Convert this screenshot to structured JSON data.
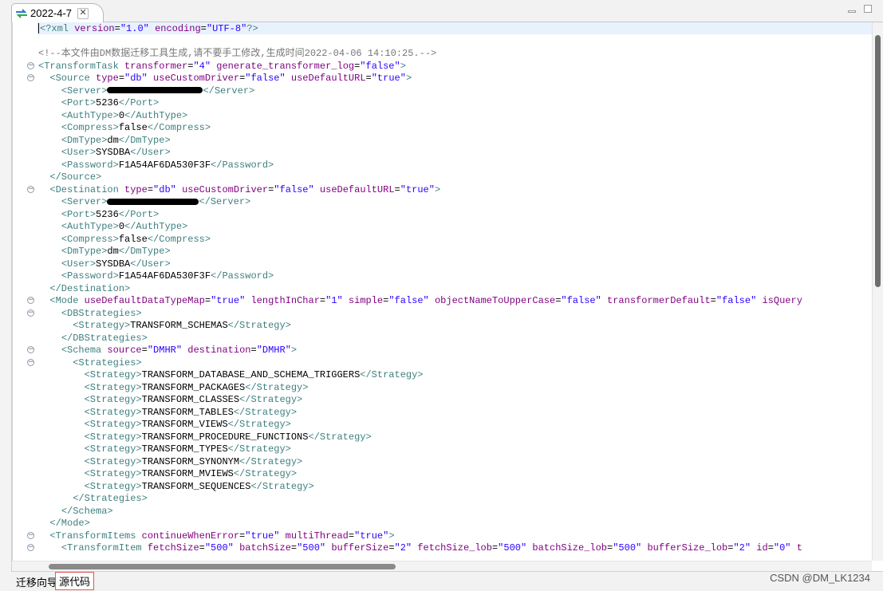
{
  "tab": {
    "title": "2022-4-7",
    "close": "✕"
  },
  "window_buttons": [
    "minimize-icon",
    "maximize-icon"
  ],
  "code_lines": [
    {
      "fold": false,
      "tokens": [
        [
          "caret",
          ""
        ],
        [
          "t",
          "<?"
        ],
        [
          "t",
          "xml "
        ],
        [
          "a",
          "version"
        ],
        [
          "x",
          "="
        ],
        [
          "v",
          "\"1.0\""
        ],
        [
          "x",
          " "
        ],
        [
          "a",
          "encoding"
        ],
        [
          "x",
          "="
        ],
        [
          "v",
          "\"UTF-8\""
        ],
        [
          "t",
          "?>"
        ]
      ]
    },
    {
      "fold": false,
      "tokens": []
    },
    {
      "fold": false,
      "tokens": [
        [
          "c",
          "<!--本文件由DM数据迁移工具生成,请不要手工修改,生成时间2022-04-06 14:10:25.-->"
        ]
      ]
    },
    {
      "fold": true,
      "tokens": [
        [
          "t",
          "<TransformTask "
        ],
        [
          "a",
          "transformer"
        ],
        [
          "x",
          "="
        ],
        [
          "v",
          "\"4\""
        ],
        [
          "x",
          " "
        ],
        [
          "a",
          "generate_transformer_log"
        ],
        [
          "x",
          "="
        ],
        [
          "v",
          "\"false\""
        ],
        [
          "t",
          ">"
        ]
      ]
    },
    {
      "fold": true,
      "tokens": [
        [
          "x",
          "  "
        ],
        [
          "t",
          "<Source "
        ],
        [
          "a",
          "type"
        ],
        [
          "x",
          "="
        ],
        [
          "v",
          "\"db\""
        ],
        [
          "x",
          " "
        ],
        [
          "a",
          "useCustomDriver"
        ],
        [
          "x",
          "="
        ],
        [
          "v",
          "\"false\""
        ],
        [
          "x",
          " "
        ],
        [
          "a",
          "useDefaultURL"
        ],
        [
          "x",
          "="
        ],
        [
          "v",
          "\"true\""
        ],
        [
          "t",
          ">"
        ]
      ]
    },
    {
      "fold": false,
      "tokens": [
        [
          "x",
          "    "
        ],
        [
          "t",
          "<Server>"
        ],
        [
          "redact",
          "120"
        ],
        [
          "t",
          "</Server>"
        ]
      ]
    },
    {
      "fold": false,
      "tokens": [
        [
          "x",
          "    "
        ],
        [
          "t",
          "<Port>"
        ],
        [
          "x",
          "5236"
        ],
        [
          "t",
          "</Port>"
        ]
      ]
    },
    {
      "fold": false,
      "tokens": [
        [
          "x",
          "    "
        ],
        [
          "t",
          "<AuthType>"
        ],
        [
          "x",
          "0"
        ],
        [
          "t",
          "</AuthType>"
        ]
      ]
    },
    {
      "fold": false,
      "tokens": [
        [
          "x",
          "    "
        ],
        [
          "t",
          "<Compress>"
        ],
        [
          "x",
          "false"
        ],
        [
          "t",
          "</Compress>"
        ]
      ]
    },
    {
      "fold": false,
      "tokens": [
        [
          "x",
          "    "
        ],
        [
          "t",
          "<DmType>"
        ],
        [
          "x",
          "dm"
        ],
        [
          "t",
          "</DmType>"
        ]
      ]
    },
    {
      "fold": false,
      "tokens": [
        [
          "x",
          "    "
        ],
        [
          "t",
          "<User>"
        ],
        [
          "x",
          "SYSDBA"
        ],
        [
          "t",
          "</User>"
        ]
      ]
    },
    {
      "fold": false,
      "tokens": [
        [
          "x",
          "    "
        ],
        [
          "t",
          "<Password>"
        ],
        [
          "x",
          "F1A54AF6DA530F3F"
        ],
        [
          "t",
          "</Password>"
        ]
      ]
    },
    {
      "fold": false,
      "tokens": [
        [
          "x",
          "  "
        ],
        [
          "t",
          "</Source>"
        ]
      ]
    },
    {
      "fold": true,
      "tokens": [
        [
          "x",
          "  "
        ],
        [
          "t",
          "<Destination "
        ],
        [
          "a",
          "type"
        ],
        [
          "x",
          "="
        ],
        [
          "v",
          "\"db\""
        ],
        [
          "x",
          " "
        ],
        [
          "a",
          "useCustomDriver"
        ],
        [
          "x",
          "="
        ],
        [
          "v",
          "\"false\""
        ],
        [
          "x",
          " "
        ],
        [
          "a",
          "useDefaultURL"
        ],
        [
          "x",
          "="
        ],
        [
          "v",
          "\"true\""
        ],
        [
          "t",
          ">"
        ]
      ]
    },
    {
      "fold": false,
      "tokens": [
        [
          "x",
          "    "
        ],
        [
          "t",
          "<Server>"
        ],
        [
          "redact",
          "115"
        ],
        [
          "t",
          "</Server>"
        ]
      ]
    },
    {
      "fold": false,
      "tokens": [
        [
          "x",
          "    "
        ],
        [
          "t",
          "<Port>"
        ],
        [
          "x",
          "5236"
        ],
        [
          "t",
          "</Port>"
        ]
      ]
    },
    {
      "fold": false,
      "tokens": [
        [
          "x",
          "    "
        ],
        [
          "t",
          "<AuthType>"
        ],
        [
          "x",
          "0"
        ],
        [
          "t",
          "</AuthType>"
        ]
      ]
    },
    {
      "fold": false,
      "tokens": [
        [
          "x",
          "    "
        ],
        [
          "t",
          "<Compress>"
        ],
        [
          "x",
          "false"
        ],
        [
          "t",
          "</Compress>"
        ]
      ]
    },
    {
      "fold": false,
      "tokens": [
        [
          "x",
          "    "
        ],
        [
          "t",
          "<DmType>"
        ],
        [
          "x",
          "dm"
        ],
        [
          "t",
          "</DmType>"
        ]
      ]
    },
    {
      "fold": false,
      "tokens": [
        [
          "x",
          "    "
        ],
        [
          "t",
          "<User>"
        ],
        [
          "x",
          "SYSDBA"
        ],
        [
          "t",
          "</User>"
        ]
      ]
    },
    {
      "fold": false,
      "tokens": [
        [
          "x",
          "    "
        ],
        [
          "t",
          "<Password>"
        ],
        [
          "x",
          "F1A54AF6DA530F3F"
        ],
        [
          "t",
          "</Password>"
        ]
      ]
    },
    {
      "fold": false,
      "tokens": [
        [
          "x",
          "  "
        ],
        [
          "t",
          "</Destination>"
        ]
      ]
    },
    {
      "fold": true,
      "tokens": [
        [
          "x",
          "  "
        ],
        [
          "t",
          "<Mode "
        ],
        [
          "a",
          "useDefaultDataTypeMap"
        ],
        [
          "x",
          "="
        ],
        [
          "v",
          "\"true\""
        ],
        [
          "x",
          " "
        ],
        [
          "a",
          "lengthInChar"
        ],
        [
          "x",
          "="
        ],
        [
          "v",
          "\"1\""
        ],
        [
          "x",
          " "
        ],
        [
          "a",
          "simple"
        ],
        [
          "x",
          "="
        ],
        [
          "v",
          "\"false\""
        ],
        [
          "x",
          " "
        ],
        [
          "a",
          "objectNameToUpperCase"
        ],
        [
          "x",
          "="
        ],
        [
          "v",
          "\"false\""
        ],
        [
          "x",
          " "
        ],
        [
          "a",
          "transformerDefault"
        ],
        [
          "x",
          "="
        ],
        [
          "v",
          "\"false\""
        ],
        [
          "x",
          " "
        ],
        [
          "a",
          "isQuery"
        ]
      ]
    },
    {
      "fold": true,
      "tokens": [
        [
          "x",
          "    "
        ],
        [
          "t",
          "<DBStrategies>"
        ]
      ]
    },
    {
      "fold": false,
      "tokens": [
        [
          "x",
          "      "
        ],
        [
          "t",
          "<Strategy>"
        ],
        [
          "x",
          "TRANSFORM_SCHEMAS"
        ],
        [
          "t",
          "</Strategy>"
        ]
      ]
    },
    {
      "fold": false,
      "tokens": [
        [
          "x",
          "    "
        ],
        [
          "t",
          "</DBStrategies>"
        ]
      ]
    },
    {
      "fold": true,
      "tokens": [
        [
          "x",
          "    "
        ],
        [
          "t",
          "<Schema "
        ],
        [
          "a",
          "source"
        ],
        [
          "x",
          "="
        ],
        [
          "v",
          "\"DMHR\""
        ],
        [
          "x",
          " "
        ],
        [
          "a",
          "destination"
        ],
        [
          "x",
          "="
        ],
        [
          "v",
          "\"DMHR\""
        ],
        [
          "t",
          ">"
        ]
      ]
    },
    {
      "fold": true,
      "tokens": [
        [
          "x",
          "      "
        ],
        [
          "t",
          "<Strategies>"
        ]
      ]
    },
    {
      "fold": false,
      "tokens": [
        [
          "x",
          "        "
        ],
        [
          "t",
          "<Strategy>"
        ],
        [
          "x",
          "TRANSFORM_DATABASE_AND_SCHEMA_TRIGGERS"
        ],
        [
          "t",
          "</Strategy>"
        ]
      ]
    },
    {
      "fold": false,
      "tokens": [
        [
          "x",
          "        "
        ],
        [
          "t",
          "<Strategy>"
        ],
        [
          "x",
          "TRANSFORM_PACKAGES"
        ],
        [
          "t",
          "</Strategy>"
        ]
      ]
    },
    {
      "fold": false,
      "tokens": [
        [
          "x",
          "        "
        ],
        [
          "t",
          "<Strategy>"
        ],
        [
          "x",
          "TRANSFORM_CLASSES"
        ],
        [
          "t",
          "</Strategy>"
        ]
      ]
    },
    {
      "fold": false,
      "tokens": [
        [
          "x",
          "        "
        ],
        [
          "t",
          "<Strategy>"
        ],
        [
          "x",
          "TRANSFORM_TABLES"
        ],
        [
          "t",
          "</Strategy>"
        ]
      ]
    },
    {
      "fold": false,
      "tokens": [
        [
          "x",
          "        "
        ],
        [
          "t",
          "<Strategy>"
        ],
        [
          "x",
          "TRANSFORM_VIEWS"
        ],
        [
          "t",
          "</Strategy>"
        ]
      ]
    },
    {
      "fold": false,
      "tokens": [
        [
          "x",
          "        "
        ],
        [
          "t",
          "<Strategy>"
        ],
        [
          "x",
          "TRANSFORM_PROCEDURE_FUNCTIONS"
        ],
        [
          "t",
          "</Strategy>"
        ]
      ]
    },
    {
      "fold": false,
      "tokens": [
        [
          "x",
          "        "
        ],
        [
          "t",
          "<Strategy>"
        ],
        [
          "x",
          "TRANSFORM_TYPES"
        ],
        [
          "t",
          "</Strategy>"
        ]
      ]
    },
    {
      "fold": false,
      "tokens": [
        [
          "x",
          "        "
        ],
        [
          "t",
          "<Strategy>"
        ],
        [
          "x",
          "TRANSFORM_SYNONYM"
        ],
        [
          "t",
          "</Strategy>"
        ]
      ]
    },
    {
      "fold": false,
      "tokens": [
        [
          "x",
          "        "
        ],
        [
          "t",
          "<Strategy>"
        ],
        [
          "x",
          "TRANSFORM_MVIEWS"
        ],
        [
          "t",
          "</Strategy>"
        ]
      ]
    },
    {
      "fold": false,
      "tokens": [
        [
          "x",
          "        "
        ],
        [
          "t",
          "<Strategy>"
        ],
        [
          "x",
          "TRANSFORM_SEQUENCES"
        ],
        [
          "t",
          "</Strategy>"
        ]
      ]
    },
    {
      "fold": false,
      "tokens": [
        [
          "x",
          "      "
        ],
        [
          "t",
          "</Strategies>"
        ]
      ]
    },
    {
      "fold": false,
      "tokens": [
        [
          "x",
          "    "
        ],
        [
          "t",
          "</Schema>"
        ]
      ]
    },
    {
      "fold": false,
      "tokens": [
        [
          "x",
          "  "
        ],
        [
          "t",
          "</Mode>"
        ]
      ]
    },
    {
      "fold": true,
      "tokens": [
        [
          "x",
          "  "
        ],
        [
          "t",
          "<TransformItems "
        ],
        [
          "a",
          "continueWhenError"
        ],
        [
          "x",
          "="
        ],
        [
          "v",
          "\"true\""
        ],
        [
          "x",
          " "
        ],
        [
          "a",
          "multiThread"
        ],
        [
          "x",
          "="
        ],
        [
          "v",
          "\"true\""
        ],
        [
          "t",
          ">"
        ]
      ]
    },
    {
      "fold": true,
      "tokens": [
        [
          "x",
          "    "
        ],
        [
          "t",
          "<TransformItem "
        ],
        [
          "a",
          "fetchSize"
        ],
        [
          "x",
          "="
        ],
        [
          "v",
          "\"500\""
        ],
        [
          "x",
          " "
        ],
        [
          "a",
          "batchSize"
        ],
        [
          "x",
          "="
        ],
        [
          "v",
          "\"500\""
        ],
        [
          "x",
          " "
        ],
        [
          "a",
          "bufferSize"
        ],
        [
          "x",
          "="
        ],
        [
          "v",
          "\"2\""
        ],
        [
          "x",
          " "
        ],
        [
          "a",
          "fetchSize_lob"
        ],
        [
          "x",
          "="
        ],
        [
          "v",
          "\"500\""
        ],
        [
          "x",
          " "
        ],
        [
          "a",
          "batchSize_lob"
        ],
        [
          "x",
          "="
        ],
        [
          "v",
          "\"500\""
        ],
        [
          "x",
          " "
        ],
        [
          "a",
          "bufferSize_lob"
        ],
        [
          "x",
          "="
        ],
        [
          "v",
          "\"2\""
        ],
        [
          "x",
          " "
        ],
        [
          "a",
          "id"
        ],
        [
          "x",
          "="
        ],
        [
          "v",
          "\"0\""
        ],
        [
          "x",
          " "
        ],
        [
          "a",
          "t"
        ]
      ]
    }
  ],
  "bottom_tabs": {
    "wizard": "迁移向导",
    "source": "源代码"
  },
  "watermark": "CSDN @DM_LK1234"
}
